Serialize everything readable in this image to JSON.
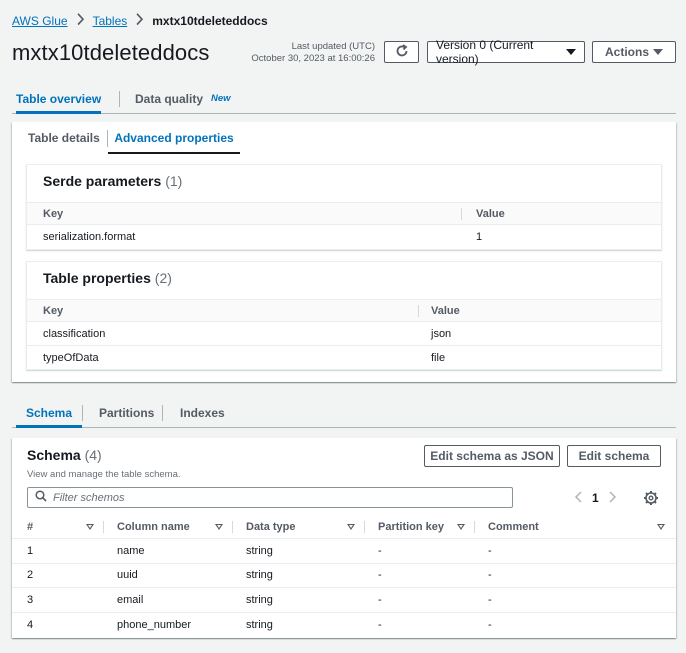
{
  "breadcrumb": {
    "root": "AWS Glue",
    "tables": "Tables",
    "current": "mxtx10tdeleteddocs"
  },
  "title": "mxtx10tdeleteddocs",
  "last_updated": {
    "label": "Last updated (UTC)",
    "value": "October 30, 2023 at 16:00:26"
  },
  "toolbar": {
    "version": "Version 0 (Current version)",
    "actions": "Actions"
  },
  "top_tabs": [
    {
      "label": "Table overview",
      "active": true
    },
    {
      "label": "Data quality",
      "badge": "New",
      "active": false
    }
  ],
  "sub_tabs": [
    {
      "label": "Table details",
      "active": false
    },
    {
      "label": "Advanced properties",
      "active": true
    }
  ],
  "serde": {
    "title": "Serde parameters",
    "count": "(1)",
    "columns": [
      "Key",
      "Value"
    ],
    "rows": [
      [
        "serialization.format",
        "1"
      ]
    ]
  },
  "table_properties": {
    "title": "Table properties",
    "count": "(2)",
    "columns": [
      "Key",
      "Value"
    ],
    "rows": [
      [
        "classification",
        "json"
      ],
      [
        "typeOfData",
        "file"
      ]
    ]
  },
  "bottom_tabs": [
    {
      "label": "Schema",
      "active": true
    },
    {
      "label": "Partitions",
      "active": false
    },
    {
      "label": "Indexes",
      "active": false
    }
  ],
  "schema": {
    "title": "Schema",
    "count": "(4)",
    "description": "View and manage the table schema.",
    "edit_json_label": "Edit schema as JSON",
    "edit_label": "Edit schema",
    "filter_placeholder": "Filter schemos",
    "page": "1",
    "columns": [
      "#",
      "Column name",
      "Data type",
      "Partition key",
      "Comment"
    ],
    "rows": [
      [
        "1",
        "name",
        "string",
        "-",
        "-"
      ],
      [
        "2",
        "uuid",
        "string",
        "-",
        "-"
      ],
      [
        "3",
        "email",
        "string",
        "-",
        "-"
      ],
      [
        "4",
        "phone_number",
        "string",
        "-",
        "-"
      ]
    ]
  },
  "icons": [
    "chevron-right-icon",
    "refresh-icon",
    "caret-down-icon",
    "search-icon",
    "chevron-left-icon",
    "gear-icon",
    "sort-icon"
  ],
  "colors": {
    "link": "#0073bb",
    "background": "#f2f3f3",
    "text": "#16191f",
    "muted": "#545b64"
  }
}
